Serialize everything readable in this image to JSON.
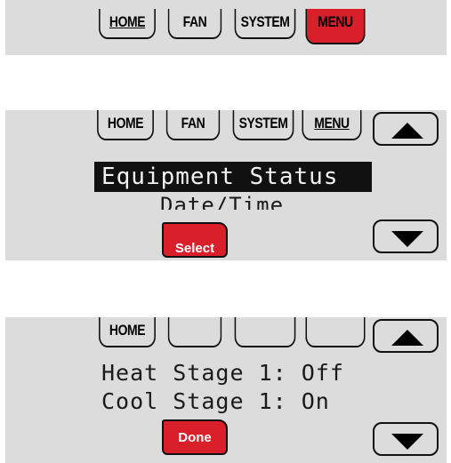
{
  "screen1": {
    "tabs": {
      "home": "HOME",
      "fan": "FAN",
      "system": "SYSTEM",
      "menu": "MENU"
    },
    "active_tab": "MENU"
  },
  "screen2": {
    "tabs": {
      "home": "HOME",
      "fan": "FAN",
      "system": "SYSTEM",
      "menu": "MENU"
    },
    "highlighted_item": "Equipment Status",
    "next_item": "Date/Time",
    "select_button": "Select",
    "up_icon": "up-arrow-icon",
    "down_icon": "down-arrow-icon"
  },
  "screen3": {
    "tabs": {
      "home": "HOME"
    },
    "lines": [
      "Heat Stage 1: Off",
      "Cool Stage 1: On"
    ],
    "done_button": "Done",
    "up_icon": "up-arrow-icon",
    "down_icon": "down-arrow-icon"
  },
  "colors": {
    "panel": "#dcdcdc",
    "accent_red": "#d81f2a",
    "lcd_text": "#1a1a1a",
    "highlight_bg": "#111111"
  }
}
